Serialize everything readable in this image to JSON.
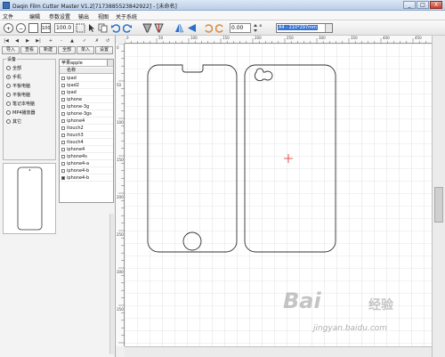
{
  "window": {
    "title": "Daqin Film Cutter Master  V1.2[7173885523842922] - [未命名]",
    "min_label": "_",
    "max_label": "□",
    "close_label": "X"
  },
  "menu": [
    "文件",
    "编辑",
    "参数设置",
    "输出",
    "视图",
    "关于系统"
  ],
  "toolbar": {
    "btn_100": "100",
    "zoom_value": "100.0",
    "angle_value": "0.00",
    "degree_symbol": "°",
    "paper_size": "A4 - 210*297mm"
  },
  "left": {
    "nav": [
      "|◀",
      "◀",
      "▶",
      "▶|",
      "+",
      "-",
      "▲",
      "✓",
      "✗",
      "↺"
    ],
    "actions": [
      "导入",
      "查看",
      "新建",
      "全部",
      "单入",
      "设置"
    ],
    "group_title": "设备",
    "radios": [
      {
        "label": "全部",
        "selected": false
      },
      {
        "label": "手机",
        "selected": true
      },
      {
        "label": "平板电脑",
        "selected": false
      },
      {
        "label": "平板电脑",
        "selected": false
      },
      {
        "label": "笔记本电脑",
        "selected": false
      },
      {
        "label": "MP4播放器",
        "selected": false
      },
      {
        "label": "其它",
        "selected": false
      }
    ],
    "brand": "苹果apple",
    "list_header": "名称",
    "list_items": [
      "ipad",
      "ipad2",
      "ipad",
      "iphone",
      "iphone-3g",
      "iphone-3gs",
      "iphone4",
      "itouch2",
      "itouch3",
      "itouch4",
      "iphone4",
      "iphone4s",
      "iphone4-a",
      "iphone4-b",
      "iphone4-b"
    ]
  },
  "ruler": {
    "h_labels": [
      "0",
      "50",
      "100",
      "150",
      "200",
      "250",
      "300",
      "350",
      "400",
      "450"
    ],
    "v_labels": [
      "0",
      "50",
      "100",
      "150",
      "200",
      "250",
      "300",
      "350"
    ]
  },
  "watermark": {
    "brand": "Bai",
    "brand2": "经验",
    "url": "jingyan.baidu.com"
  },
  "colors": {
    "grid": "#c8c8c8",
    "outline": "#333333",
    "crosshair": "#d93030",
    "selection": "#3875d7"
  }
}
